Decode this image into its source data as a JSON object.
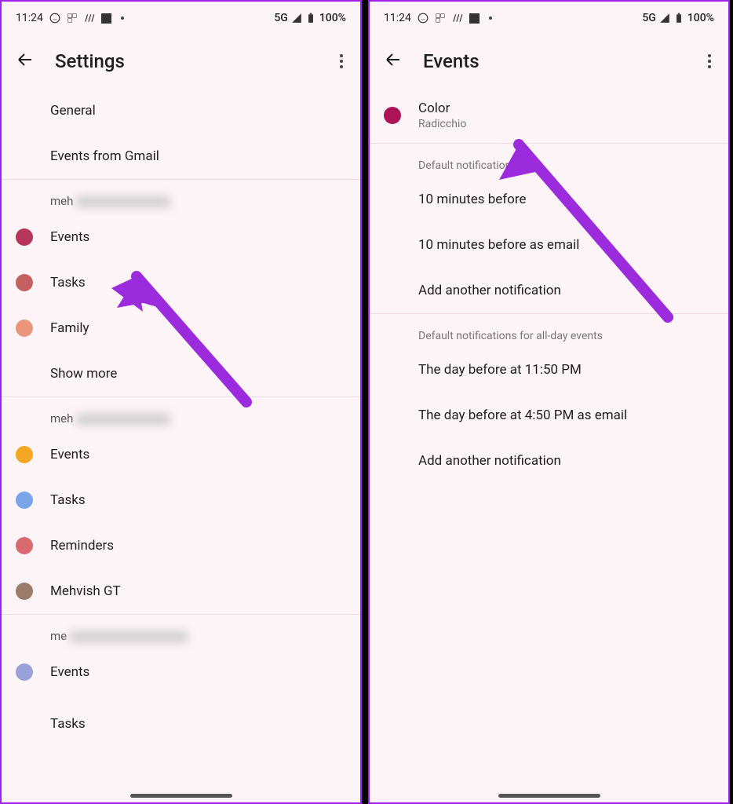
{
  "status": {
    "time": "11:24",
    "network": "5G",
    "battery": "100%"
  },
  "left": {
    "title": "Settings",
    "general": "General",
    "events_gmail": "Events from Gmail",
    "account1_prefix": "meh",
    "acc1": {
      "events": "Events",
      "tasks": "Tasks",
      "family": "Family",
      "showmore": "Show more"
    },
    "account2_prefix": "meh",
    "acc2": {
      "events": "Events",
      "tasks": "Tasks",
      "reminders": "Reminders",
      "custom": "Mehvish GT"
    },
    "account3_prefix": "me",
    "acc3": {
      "events": "Events",
      "tasks": "Tasks"
    }
  },
  "right": {
    "title": "Events",
    "color_label": "Color",
    "color_value": "Radicchio",
    "section1_header": "Default notifications",
    "notif1": "10 minutes before",
    "notif2": "10 minutes before as email",
    "add1": "Add another notification",
    "section2_header": "Default notifications for all-day events",
    "allday1": "The day before at 11:50 PM",
    "allday2": "The day before at 4:50 PM as email",
    "add2": "Add another notification"
  },
  "colors": {
    "radicchio": "#ad1457",
    "acc1_events": "#b5365a",
    "acc1_tasks": "#c4605f",
    "acc1_family": "#e9967a",
    "acc2_events": "#f5a623",
    "acc2_tasks": "#7aa5e8",
    "acc2_reminders": "#d96a70",
    "acc2_custom": "#9b7b6a",
    "acc3_events": "#9aa0d8"
  }
}
